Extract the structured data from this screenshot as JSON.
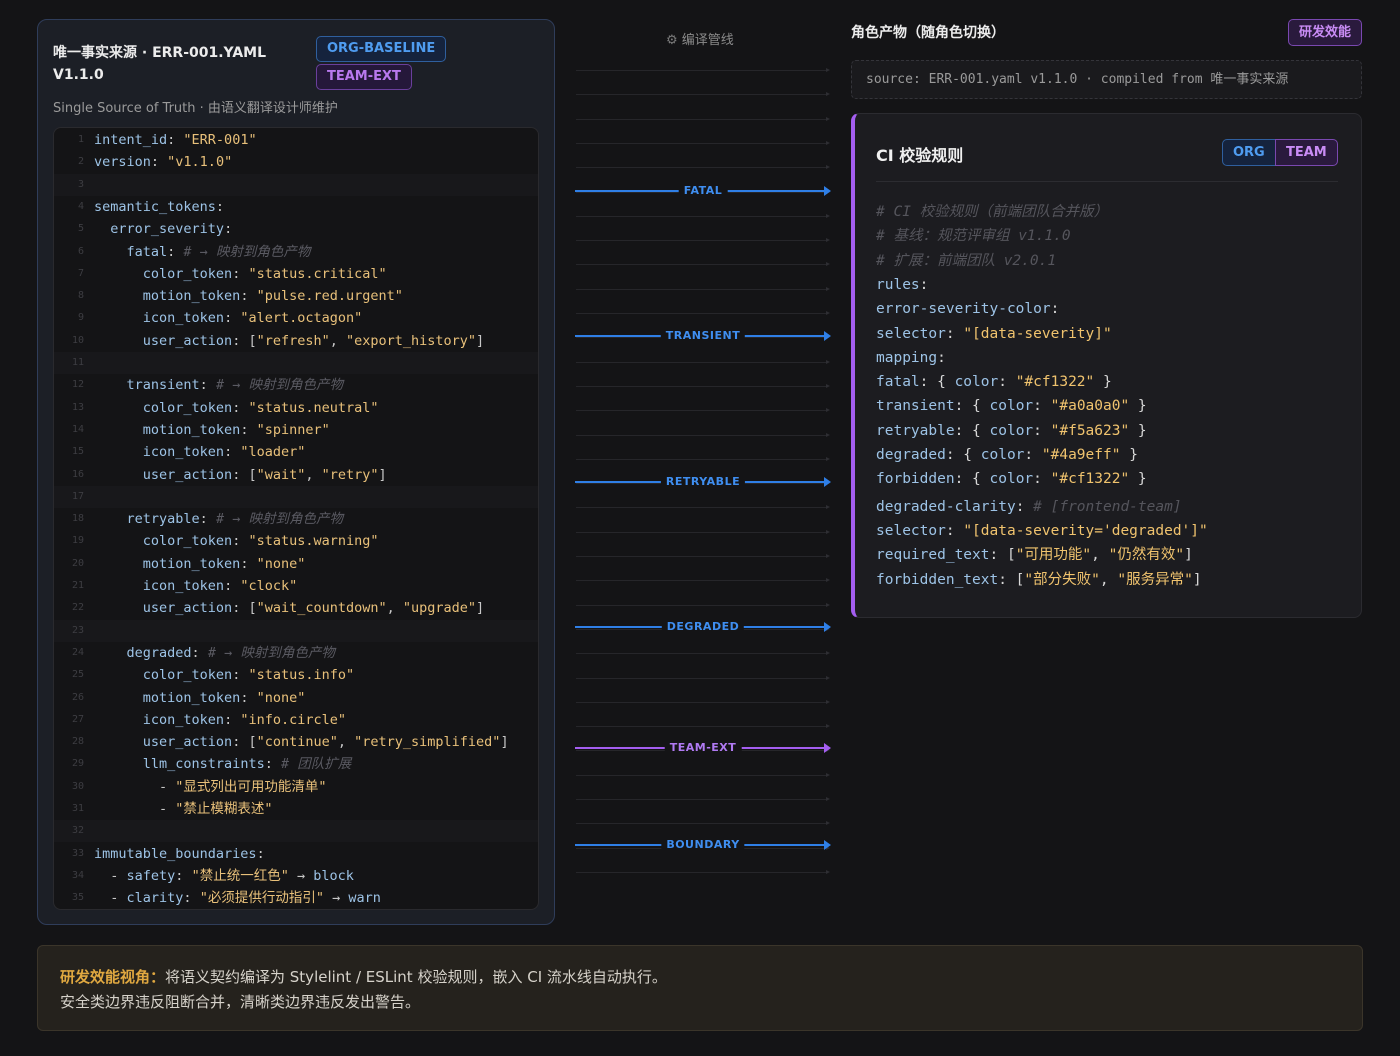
{
  "left": {
    "title": "唯一事实来源 · ERR-001.YAML V1.1.0",
    "badges": {
      "org": "ORG-BASELINE",
      "team": "TEAM-EXT"
    },
    "subtitle": "Single Source of Truth · 由语义翻译设计师维护",
    "code": [
      {
        "n": "1",
        "parts": [
          [
            "k",
            "intent_id"
          ],
          [
            "p",
            ": "
          ],
          [
            "s",
            "\"ERR-001\""
          ]
        ]
      },
      {
        "n": "2",
        "parts": [
          [
            "k",
            "version"
          ],
          [
            "p",
            ": "
          ],
          [
            "s",
            "\"v1.1.0\""
          ]
        ]
      },
      {
        "n": "3",
        "parts": []
      },
      {
        "n": "4",
        "parts": [
          [
            "k",
            "semantic_tokens"
          ],
          [
            "p",
            ":"
          ]
        ]
      },
      {
        "n": "5",
        "parts": [
          [
            "p",
            "  "
          ],
          [
            "k",
            "error_severity"
          ],
          [
            "p",
            ":"
          ]
        ]
      },
      {
        "n": "6",
        "parts": [
          [
            "p",
            "    "
          ],
          [
            "k",
            "fatal"
          ],
          [
            "p",
            ": "
          ],
          [
            "c",
            "# → 映射到角色产物"
          ]
        ]
      },
      {
        "n": "7",
        "parts": [
          [
            "p",
            "      "
          ],
          [
            "k",
            "color_token"
          ],
          [
            "p",
            ": "
          ],
          [
            "s",
            "\"status.critical\""
          ]
        ]
      },
      {
        "n": "8",
        "parts": [
          [
            "p",
            "      "
          ],
          [
            "k",
            "motion_token"
          ],
          [
            "p",
            ": "
          ],
          [
            "s",
            "\"pulse.red.urgent\""
          ]
        ]
      },
      {
        "n": "9",
        "parts": [
          [
            "p",
            "      "
          ],
          [
            "k",
            "icon_token"
          ],
          [
            "p",
            ": "
          ],
          [
            "s",
            "\"alert.octagon\""
          ]
        ]
      },
      {
        "n": "10",
        "parts": [
          [
            "p",
            "      "
          ],
          [
            "k",
            "user_action"
          ],
          [
            "p",
            ": ["
          ],
          [
            "s",
            "\"refresh\""
          ],
          [
            "p",
            ", "
          ],
          [
            "s",
            "\"export_history\""
          ],
          [
            "p",
            "]"
          ]
        ]
      },
      {
        "n": "11",
        "parts": []
      },
      {
        "n": "12",
        "parts": [
          [
            "p",
            "    "
          ],
          [
            "k",
            "transient"
          ],
          [
            "p",
            ": "
          ],
          [
            "c",
            "# → 映射到角色产物"
          ]
        ]
      },
      {
        "n": "13",
        "parts": [
          [
            "p",
            "      "
          ],
          [
            "k",
            "color_token"
          ],
          [
            "p",
            ": "
          ],
          [
            "s",
            "\"status.neutral\""
          ]
        ]
      },
      {
        "n": "14",
        "parts": [
          [
            "p",
            "      "
          ],
          [
            "k",
            "motion_token"
          ],
          [
            "p",
            ": "
          ],
          [
            "s",
            "\"spinner\""
          ]
        ]
      },
      {
        "n": "15",
        "parts": [
          [
            "p",
            "      "
          ],
          [
            "k",
            "icon_token"
          ],
          [
            "p",
            ": "
          ],
          [
            "s",
            "\"loader\""
          ]
        ]
      },
      {
        "n": "16",
        "parts": [
          [
            "p",
            "      "
          ],
          [
            "k",
            "user_action"
          ],
          [
            "p",
            ": ["
          ],
          [
            "s",
            "\"wait\""
          ],
          [
            "p",
            ", "
          ],
          [
            "s",
            "\"retry\""
          ],
          [
            "p",
            "]"
          ]
        ]
      },
      {
        "n": "17",
        "parts": []
      },
      {
        "n": "18",
        "parts": [
          [
            "p",
            "    "
          ],
          [
            "k",
            "retryable"
          ],
          [
            "p",
            ": "
          ],
          [
            "c",
            "# → 映射到角色产物"
          ]
        ]
      },
      {
        "n": "19",
        "parts": [
          [
            "p",
            "      "
          ],
          [
            "k",
            "color_token"
          ],
          [
            "p",
            ": "
          ],
          [
            "s",
            "\"status.warning\""
          ]
        ]
      },
      {
        "n": "20",
        "parts": [
          [
            "p",
            "      "
          ],
          [
            "k",
            "motion_token"
          ],
          [
            "p",
            ": "
          ],
          [
            "s",
            "\"none\""
          ]
        ]
      },
      {
        "n": "21",
        "parts": [
          [
            "p",
            "      "
          ],
          [
            "k",
            "icon_token"
          ],
          [
            "p",
            ": "
          ],
          [
            "s",
            "\"clock\""
          ]
        ]
      },
      {
        "n": "22",
        "parts": [
          [
            "p",
            "      "
          ],
          [
            "k",
            "user_action"
          ],
          [
            "p",
            ": ["
          ],
          [
            "s",
            "\"wait_countdown\""
          ],
          [
            "p",
            ", "
          ],
          [
            "s",
            "\"upgrade\""
          ],
          [
            "p",
            "]"
          ]
        ]
      },
      {
        "n": "23",
        "parts": []
      },
      {
        "n": "24",
        "parts": [
          [
            "p",
            "    "
          ],
          [
            "k",
            "degraded"
          ],
          [
            "p",
            ": "
          ],
          [
            "c",
            "# → 映射到角色产物"
          ]
        ]
      },
      {
        "n": "25",
        "parts": [
          [
            "p",
            "      "
          ],
          [
            "k",
            "color_token"
          ],
          [
            "p",
            ": "
          ],
          [
            "s",
            "\"status.info\""
          ]
        ]
      },
      {
        "n": "26",
        "parts": [
          [
            "p",
            "      "
          ],
          [
            "k",
            "motion_token"
          ],
          [
            "p",
            ": "
          ],
          [
            "s",
            "\"none\""
          ]
        ]
      },
      {
        "n": "27",
        "parts": [
          [
            "p",
            "      "
          ],
          [
            "k",
            "icon_token"
          ],
          [
            "p",
            ": "
          ],
          [
            "s",
            "\"info.circle\""
          ]
        ]
      },
      {
        "n": "28",
        "parts": [
          [
            "p",
            "      "
          ],
          [
            "k",
            "user_action"
          ],
          [
            "p",
            ": ["
          ],
          [
            "s",
            "\"continue\""
          ],
          [
            "p",
            ", "
          ],
          [
            "s",
            "\"retry_simplified\""
          ],
          [
            "p",
            "]"
          ]
        ]
      },
      {
        "n": "29",
        "parts": [
          [
            "p",
            "      "
          ],
          [
            "k",
            "llm_constraints"
          ],
          [
            "p",
            ": "
          ],
          [
            "c",
            "# 团队扩展"
          ]
        ]
      },
      {
        "n": "30",
        "parts": [
          [
            "p",
            "        - "
          ],
          [
            "s",
            "\"显式列出可用功能清单\""
          ]
        ]
      },
      {
        "n": "31",
        "parts": [
          [
            "p",
            "        - "
          ],
          [
            "s",
            "\"禁止模糊表述\""
          ]
        ]
      },
      {
        "n": "32",
        "parts": []
      },
      {
        "n": "33",
        "parts": [
          [
            "k",
            "immutable_boundaries"
          ],
          [
            "p",
            ":"
          ]
        ]
      },
      {
        "n": "34",
        "parts": [
          [
            "p",
            "  - "
          ],
          [
            "k",
            "safety"
          ],
          [
            "p",
            ": "
          ],
          [
            "s",
            "\"禁止统一红色\""
          ],
          [
            "p",
            " → "
          ],
          [
            "k",
            "block"
          ]
        ]
      },
      {
        "n": "35",
        "parts": [
          [
            "p",
            "  - "
          ],
          [
            "k",
            "clarity"
          ],
          [
            "p",
            ": "
          ],
          [
            "s",
            "\"必须提供行动指引\""
          ],
          [
            "p",
            " → "
          ],
          [
            "k",
            "warn"
          ]
        ]
      }
    ]
  },
  "pipeline": {
    "title": "编译管线",
    "flows": [
      {
        "label": "FATAL",
        "color": "#2f7fe6"
      },
      {
        "label": "TRANSIENT",
        "color": "#2f7fe6"
      },
      {
        "label": "RETRYABLE",
        "color": "#2f7fe6"
      },
      {
        "label": "DEGRADED",
        "color": "#2f7fe6"
      },
      {
        "label": "TEAM-EXT",
        "color": "#a45ef0"
      },
      {
        "label": "BOUNDARY",
        "color": "#2f7fe6"
      }
    ]
  },
  "right": {
    "title": "角色产物（随角色切换）",
    "role": "研发效能",
    "source": "source: ERR-001.yaml v1.1.0 · compiled from 唯一事实来源",
    "card": {
      "title": "CI 校验规则",
      "seg_org": "ORG",
      "seg_team": "TEAM",
      "lines": [
        {
          "cmt": true,
          "parts": [
            [
              "c",
              "# CI 校验规则（前端团队合并版）"
            ]
          ]
        },
        {
          "cmt": true,
          "parts": [
            [
              "c",
              "# 基线：规范评审组 v1.1.0"
            ]
          ]
        },
        {
          "cmt": true,
          "parts": [
            [
              "c",
              "# 扩展：前端团队 v2.0.1"
            ]
          ]
        },
        {
          "parts": [
            [
              "k",
              "rules"
            ],
            [
              "p",
              ":"
            ]
          ]
        },
        {
          "parts": [
            [
              "k",
              "error-severity-color"
            ],
            [
              "p",
              ":"
            ]
          ]
        },
        {
          "parts": [
            [
              "k",
              "selector"
            ],
            [
              "p",
              ": "
            ],
            [
              "s",
              "\"[data-severity]\""
            ]
          ]
        },
        {
          "parts": [
            [
              "k",
              "mapping"
            ],
            [
              "p",
              ":"
            ]
          ]
        },
        {
          "parts": [
            [
              "k",
              "fatal"
            ],
            [
              "p",
              ": { "
            ],
            [
              "k",
              "color"
            ],
            [
              "p",
              ": "
            ],
            [
              "s",
              "\"#cf1322\""
            ],
            [
              "p",
              " }"
            ]
          ]
        },
        {
          "parts": [
            [
              "k",
              "transient"
            ],
            [
              "p",
              ": { "
            ],
            [
              "k",
              "color"
            ],
            [
              "p",
              ": "
            ],
            [
              "s",
              "\"#a0a0a0\""
            ],
            [
              "p",
              " }"
            ]
          ]
        },
        {
          "parts": [
            [
              "k",
              "retryable"
            ],
            [
              "p",
              ": { "
            ],
            [
              "k",
              "color"
            ],
            [
              "p",
              ": "
            ],
            [
              "s",
              "\"#f5a623\""
            ],
            [
              "p",
              " }"
            ]
          ]
        },
        {
          "parts": [
            [
              "k",
              "degraded"
            ],
            [
              "p",
              ": { "
            ],
            [
              "k",
              "color"
            ],
            [
              "p",
              ": "
            ],
            [
              "s",
              "\"#4a9eff\""
            ],
            [
              "p",
              " }"
            ]
          ]
        },
        {
          "parts": [
            [
              "k",
              "forbidden"
            ],
            [
              "p",
              ": { "
            ],
            [
              "k",
              "color"
            ],
            [
              "p",
              ": "
            ],
            [
              "s",
              "\"#cf1322\""
            ],
            [
              "p",
              " }"
            ]
          ]
        },
        {
          "parts": [
            [
              "k",
              "degraded-clarity"
            ],
            [
              "p",
              ": "
            ],
            [
              "c",
              "# [frontend-team]"
            ]
          ]
        },
        {
          "parts": [
            [
              "k",
              "selector"
            ],
            [
              "p",
              ": "
            ],
            [
              "s",
              "\"[data-severity='degraded']\""
            ]
          ]
        },
        {
          "parts": [
            [
              "k",
              "required_text"
            ],
            [
              "p",
              ": ["
            ],
            [
              "s",
              "\"可用功能\""
            ],
            [
              "p",
              ", "
            ],
            [
              "s",
              "\"仍然有效\""
            ],
            [
              "p",
              "]"
            ]
          ]
        },
        {
          "parts": [
            [
              "k",
              "forbidden_text"
            ],
            [
              "p",
              ": ["
            ],
            [
              "s",
              "\"部分失败\""
            ],
            [
              "p",
              ", "
            ],
            [
              "s",
              "\"服务异常\""
            ],
            [
              "p",
              "]"
            ]
          ]
        }
      ]
    }
  },
  "note": {
    "key": "研发效能视角：",
    "line1": "将语义契约编译为 Stylelint / ESLint 校验规则，嵌入 CI 流水线自动执行。",
    "line2": "安全类边界违反阻断合并，清晰类边界违反发出警告。"
  }
}
